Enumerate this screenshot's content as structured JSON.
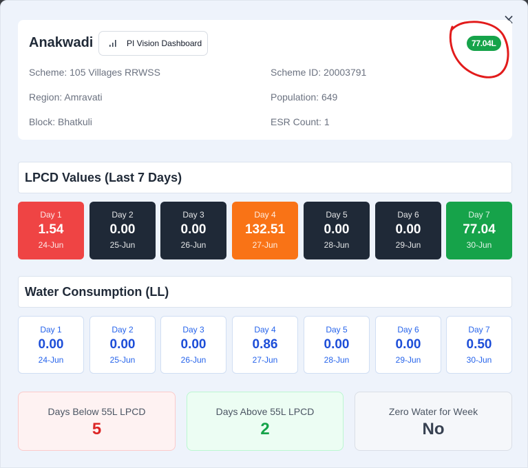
{
  "header": {
    "village": "Anakwadi",
    "pi_button_label": "PI Vision Dashboard",
    "badge_label": "77.04L",
    "close_label": "×"
  },
  "info": {
    "scheme": "Scheme: 105 Villages RRWSS",
    "scheme_id": "Scheme ID: 20003791",
    "region": "Region: Amravati",
    "population": "Population: 649",
    "block": "Block: Bhatkuli",
    "esr_count": "ESR Count: 1"
  },
  "lpcd": {
    "title": "LPCD Values (Last 7 Days)",
    "days": [
      {
        "label": "Day 1",
        "value": "1.54",
        "date": "24-Jun",
        "color": "#ef4444"
      },
      {
        "label": "Day 2",
        "value": "0.00",
        "date": "25-Jun",
        "color": "#1f2937"
      },
      {
        "label": "Day 3",
        "value": "0.00",
        "date": "26-Jun",
        "color": "#1f2937"
      },
      {
        "label": "Day 4",
        "value": "132.51",
        "date": "27-Jun",
        "color": "#f97316"
      },
      {
        "label": "Day 5",
        "value": "0.00",
        "date": "28-Jun",
        "color": "#1f2937"
      },
      {
        "label": "Day 6",
        "value": "0.00",
        "date": "29-Jun",
        "color": "#1f2937"
      },
      {
        "label": "Day 7",
        "value": "77.04",
        "date": "30-Jun",
        "color": "#16a34a"
      }
    ]
  },
  "water": {
    "title": "Water Consumption (LL)",
    "days": [
      {
        "label": "Day 1",
        "value": "0.00",
        "date": "24-Jun"
      },
      {
        "label": "Day 2",
        "value": "0.00",
        "date": "25-Jun"
      },
      {
        "label": "Day 3",
        "value": "0.00",
        "date": "26-Jun"
      },
      {
        "label": "Day 4",
        "value": "0.86",
        "date": "27-Jun"
      },
      {
        "label": "Day 5",
        "value": "0.00",
        "date": "28-Jun"
      },
      {
        "label": "Day 6",
        "value": "0.00",
        "date": "29-Jun"
      },
      {
        "label": "Day 7",
        "value": "0.50",
        "date": "30-Jun"
      }
    ]
  },
  "stats": [
    {
      "label": "Days Below 55L LPCD",
      "value": "5",
      "value_color": "#dc2626",
      "bg": "#fef2f2",
      "border": "#fbcaca"
    },
    {
      "label": "Days Above 55L LPCD",
      "value": "2",
      "value_color": "#16a34a",
      "bg": "#ecfdf3",
      "border": "#bbf7d0"
    },
    {
      "label": "Zero Water for Week",
      "value": "No",
      "value_color": "#374151",
      "bg": "#f5f7fa",
      "border": "#d9dee6"
    }
  ]
}
